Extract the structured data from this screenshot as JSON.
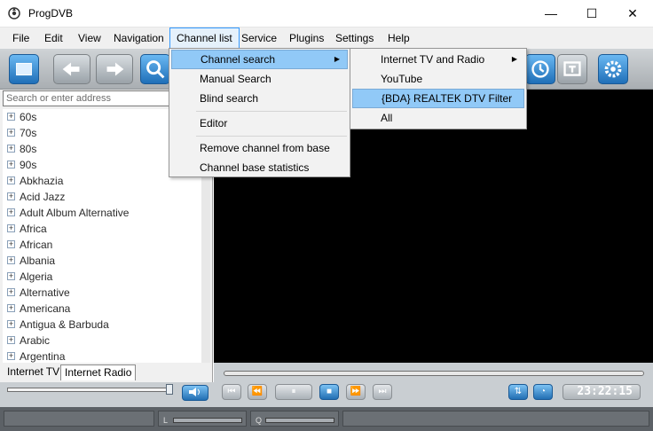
{
  "window": {
    "title": "ProgDVB",
    "minimize_glyph": "—",
    "maximize_glyph": "☐",
    "close_glyph": "✕"
  },
  "menubar": {
    "items": [
      "File",
      "Edit",
      "View",
      "Navigation",
      "Channel list",
      "Service",
      "Plugins",
      "Settings",
      "Help"
    ],
    "active": "Channel list"
  },
  "channel_list_menu": {
    "items": [
      "Channel search",
      "Manual Search",
      "Blind search",
      "Editor",
      "Remove channel from base",
      "Channel base statistics"
    ],
    "highlighted": "Channel search"
  },
  "channel_search_submenu": {
    "items": [
      "Internet TV and Radio",
      "YouTube",
      "{BDA} REALTEK DTV Filter",
      "All"
    ],
    "highlighted": "{BDA} REALTEK DTV Filter"
  },
  "sidebar": {
    "search_placeholder": "Search or enter address",
    "channels": [
      "60s",
      "70s",
      "80s",
      "90s",
      "Abkhazia",
      "Acid Jazz",
      "Adult Album Alternative",
      "Africa",
      "African",
      "Albania",
      "Algeria",
      "Alternative",
      "Americana",
      "Antigua & Barbuda",
      "Arabic",
      "Argentina"
    ],
    "tabs": [
      "Internet TV",
      "Internet Radio"
    ],
    "active_tab": "Internet Radio"
  },
  "player": {
    "time": "23:22:15",
    "volume_level": 1.0
  },
  "statusbar": {
    "left_label": "L",
    "right_label": "Q"
  },
  "colors": {
    "menu_highlight": "#91c9f7",
    "accent_blue": "#1f6fb8",
    "video_bg": "#000000"
  }
}
